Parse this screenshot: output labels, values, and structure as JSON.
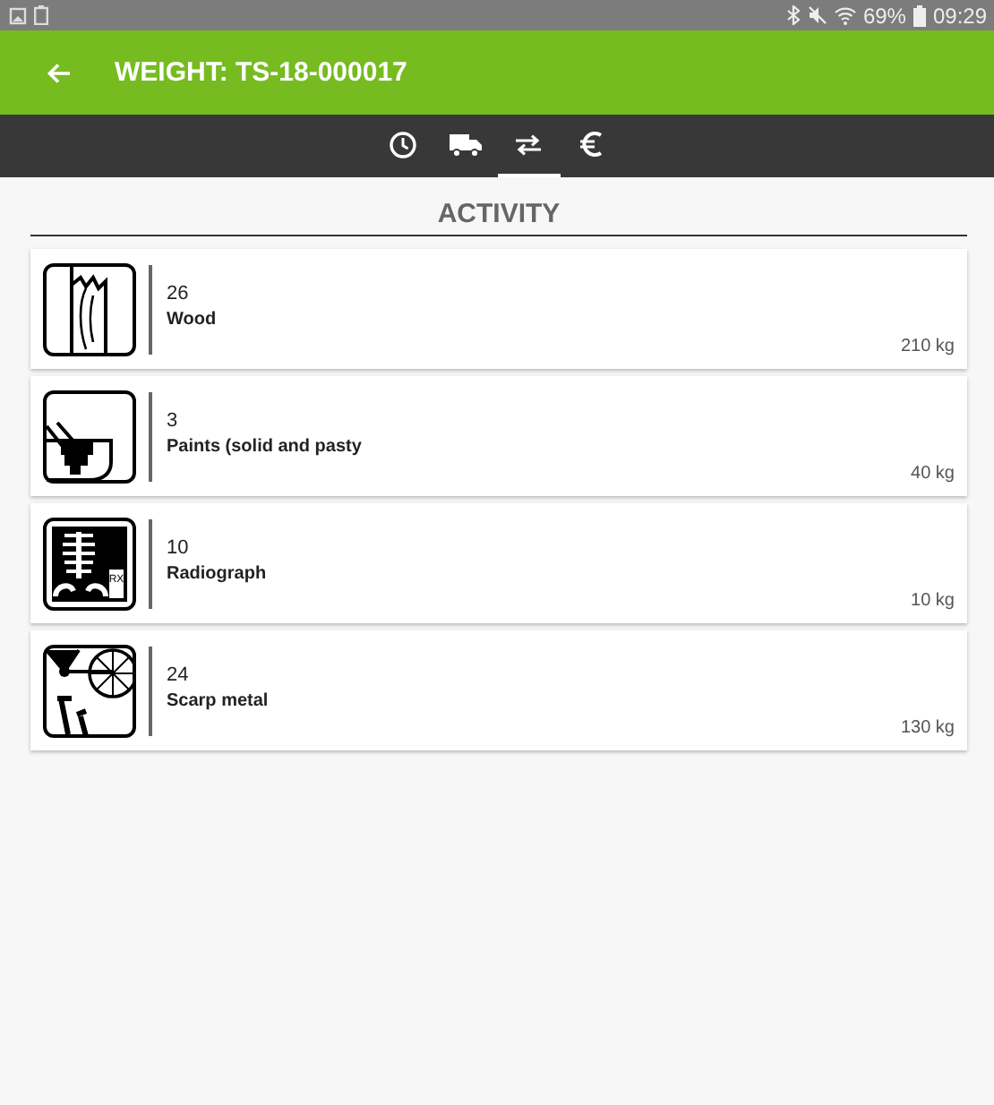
{
  "status_bar": {
    "battery": "69%",
    "time": "09:29"
  },
  "app_bar": {
    "title": "WEIGHT: TS-18-000017"
  },
  "tabs": [
    {
      "kind": "clock",
      "selected": false
    },
    {
      "kind": "truck",
      "selected": false
    },
    {
      "kind": "transfer",
      "selected": true
    },
    {
      "kind": "euro",
      "selected": false
    }
  ],
  "section_title": "ACTIVITY",
  "items": [
    {
      "kind": "wood",
      "code": "26",
      "name": "Wood",
      "weight": "210 kg"
    },
    {
      "kind": "paint",
      "code": "3",
      "name": "Paints (solid and pasty",
      "weight": "40 kg"
    },
    {
      "kind": "xray",
      "icon_text": "RX",
      "code": "10",
      "name": "Radiograph",
      "weight": "10 kg"
    },
    {
      "kind": "metal",
      "code": "24",
      "name": "Scarp metal",
      "weight": "130 kg"
    }
  ]
}
